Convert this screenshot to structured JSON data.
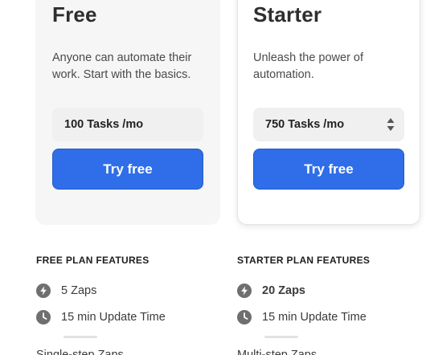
{
  "plans": {
    "free": {
      "title": "Free",
      "description": "Anyone can automate their work. Start with the basics.",
      "tasks": "100 Tasks /mo",
      "button": "Try free"
    },
    "starter": {
      "title": "Starter",
      "description": "Unleash the power of automation.",
      "tasks": "750 Tasks /mo",
      "button": "Try free"
    }
  },
  "features": {
    "free": {
      "heading": "FREE PLAN FEATURES",
      "zaps": "5 Zaps",
      "update": "15 min Update Time",
      "cut": "Single-step Zaps"
    },
    "starter": {
      "heading": "STARTER PLAN FEATURES",
      "zaps": "20 Zaps",
      "update": "15 min Update Time",
      "cut": "Multi-step Zaps"
    }
  },
  "icons": {
    "zap": "lightning-bolt",
    "clock": "clock",
    "select": "up-down-arrows"
  },
  "colors": {
    "accent": "#2f6ee8",
    "icon_gray": "#6f6f6f"
  }
}
